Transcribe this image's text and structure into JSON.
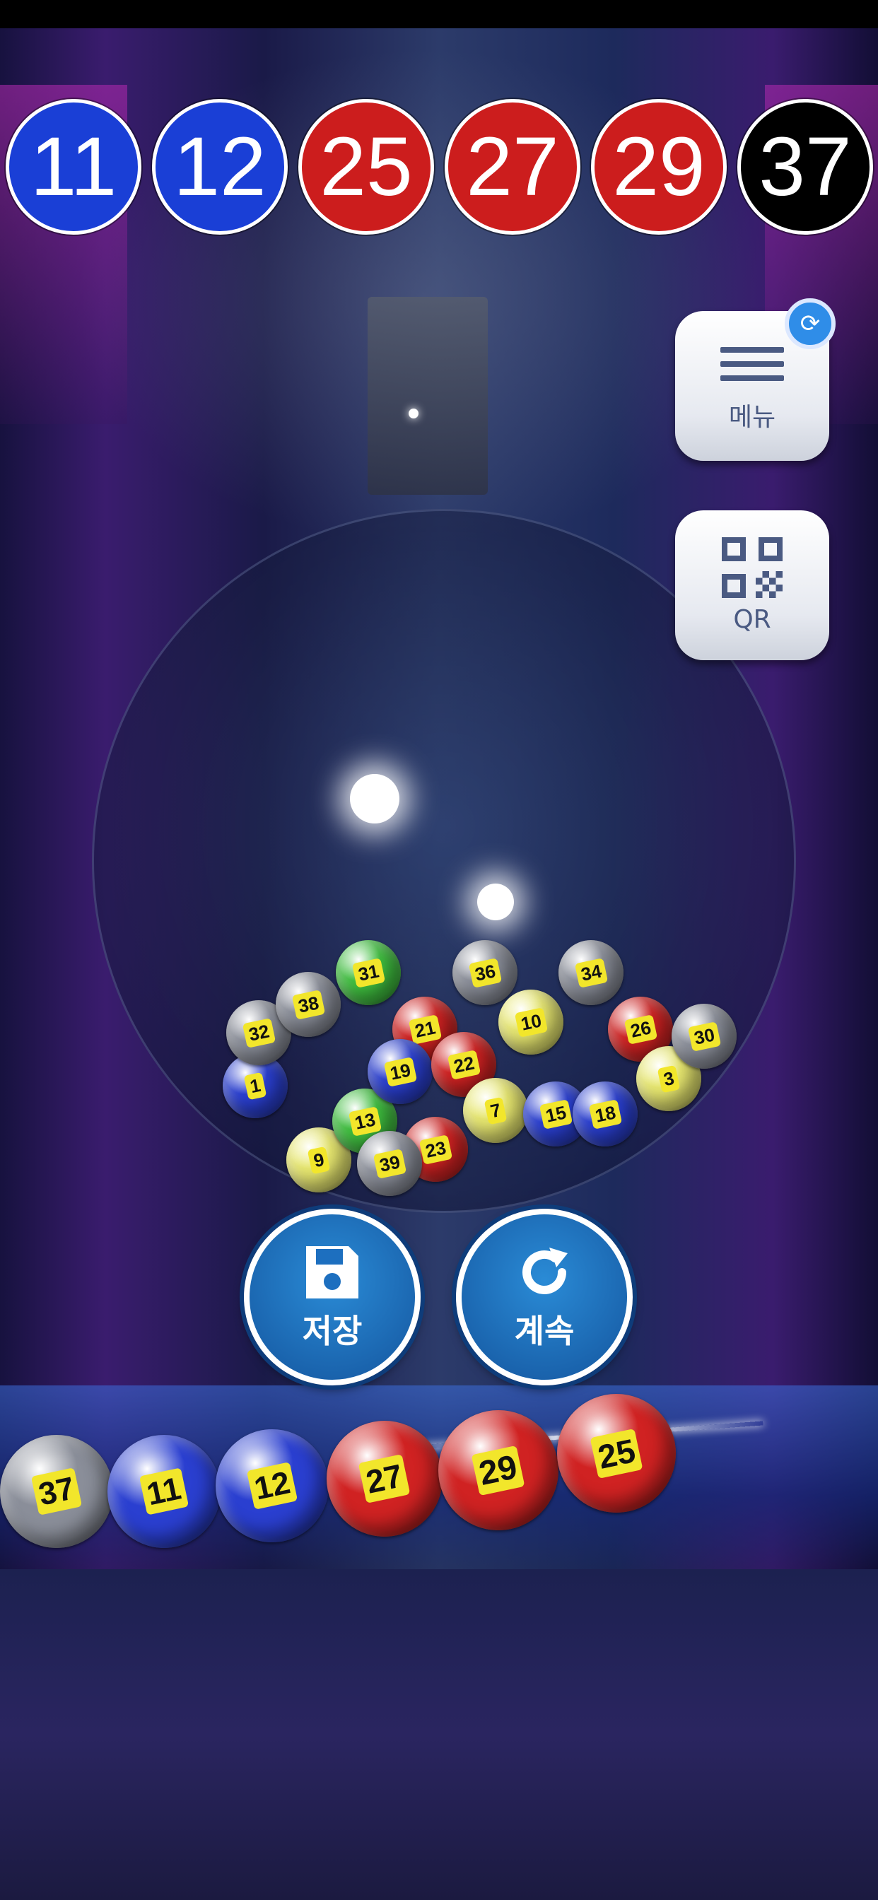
{
  "drawn_numbers": [
    {
      "value": "11",
      "color": "#1a3fd6"
    },
    {
      "value": "12",
      "color": "#1a3fd6"
    },
    {
      "value": "25",
      "color": "#cc1d1d"
    },
    {
      "value": "27",
      "color": "#cc1d1d"
    },
    {
      "value": "29",
      "color": "#cc1d1d"
    },
    {
      "value": "37",
      "color": "#000000"
    }
  ],
  "side_menu": {
    "menu_label": "메뉴",
    "menu_icon": "hamburger-icon",
    "badge_icon": "update-icon",
    "qr_label": "QR",
    "qr_icon": "qr-code-icon"
  },
  "actions": {
    "save_label": "저장",
    "save_icon": "floppy-disk-icon",
    "continue_label": "계속",
    "continue_icon": "refresh-icon"
  },
  "tray_balls": [
    {
      "value": "37",
      "color": "#8a8e99"
    },
    {
      "value": "11",
      "color": "#2a3fd0"
    },
    {
      "value": "12",
      "color": "#2a3fd0"
    },
    {
      "value": "27",
      "color": "#d02222"
    },
    {
      "value": "29",
      "color": "#d02222"
    },
    {
      "value": "25",
      "color": "#d02222"
    }
  ],
  "globe_balls": [
    {
      "value": "1",
      "color": "#2a3fd0"
    },
    {
      "value": "9",
      "color": "#e8e870"
    },
    {
      "value": "13",
      "color": "#3fbf3f"
    },
    {
      "value": "32",
      "color": "#8a8e99"
    },
    {
      "value": "38",
      "color": "#8a8e99"
    },
    {
      "value": "31",
      "color": "#3fbf3f"
    },
    {
      "value": "21",
      "color": "#d02222"
    },
    {
      "value": "36",
      "color": "#8a8e99"
    },
    {
      "value": "10",
      "color": "#e8e870"
    },
    {
      "value": "19",
      "color": "#2a3fd0"
    },
    {
      "value": "22",
      "color": "#d02222"
    },
    {
      "value": "7",
      "color": "#e8e870"
    },
    {
      "value": "34",
      "color": "#8a8e99"
    },
    {
      "value": "26",
      "color": "#d02222"
    },
    {
      "value": "15",
      "color": "#2a3fd0"
    },
    {
      "value": "23",
      "color": "#d02222"
    },
    {
      "value": "39",
      "color": "#8a8e99"
    },
    {
      "value": "18",
      "color": "#2a3fd0"
    },
    {
      "value": "3",
      "color": "#e8e870"
    },
    {
      "value": "30",
      "color": "#8a8e99"
    }
  ]
}
